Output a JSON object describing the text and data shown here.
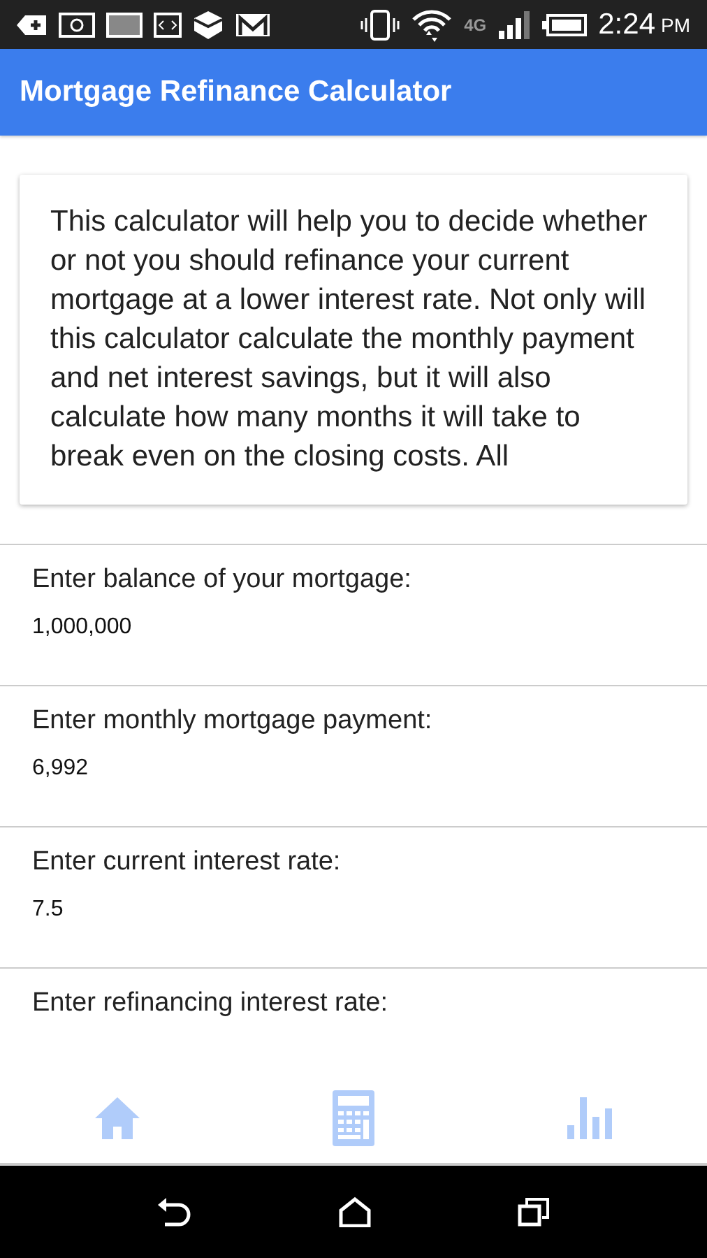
{
  "status_bar": {
    "network_type": "4G",
    "time": "2:24",
    "period": "PM"
  },
  "app_bar": {
    "title": "Mortgage Refinance Calculator"
  },
  "intro": "This calculator will help you to decide whether or not you should refinance your current mortgage at a lower interest rate. Not only will this calculator calculate the monthly payment and net interest savings, but it will also calculate how many months it will take to break even on the closing costs. All",
  "fields": [
    {
      "label": "Enter balance of your mortgage:",
      "value": "1,000,000"
    },
    {
      "label": "Enter monthly mortgage payment:",
      "value": "6,992"
    },
    {
      "label": "Enter current interest rate:",
      "value": "7.5"
    },
    {
      "label": "Enter refinancing interest rate:"
    }
  ],
  "bottom_tabs": [
    {
      "kind": "home"
    },
    {
      "kind": "calculator"
    },
    {
      "kind": "chart"
    }
  ]
}
